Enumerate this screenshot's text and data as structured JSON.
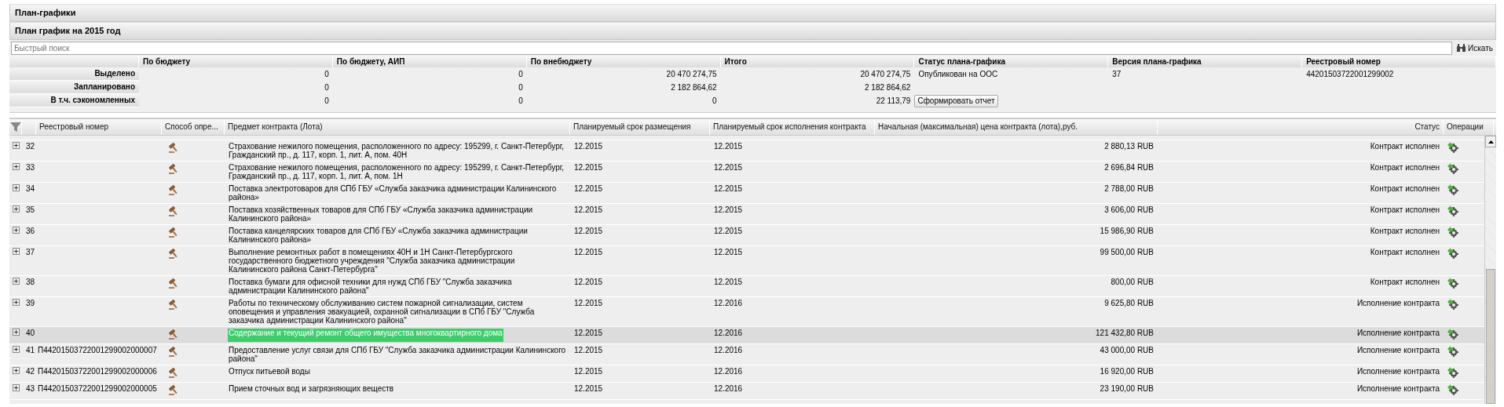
{
  "panel": {
    "title": "План-графики"
  },
  "plan": {
    "title": "План график на 2015 год"
  },
  "search": {
    "placeholder": "Быстрый поиск",
    "button": "Искать"
  },
  "summary": {
    "columns": [
      "По бюджету",
      "По бюджету, АИП",
      "По внебюджету",
      "Итого",
      "Статус плана-графика",
      "Версия плана-графика",
      "Реестровый номер"
    ],
    "rows": [
      {
        "label": "Выделено",
        "cells": [
          "0",
          "0",
          "20 470 274,75",
          "20 470 274,75",
          "Опубликован на ООС",
          "37",
          "44201503722001299002"
        ]
      },
      {
        "label": "Запланировано",
        "cells": [
          "0",
          "0",
          "2 182 864,62",
          "2 182 864,62"
        ]
      },
      {
        "label": "В т.ч. сэкономленных",
        "cells": [
          "0",
          "0",
          "0",
          "22 113,79"
        ]
      }
    ],
    "report_button": "Сформировать отчет"
  },
  "grid": {
    "columns": [
      "Реестровый номер",
      "Способ опре...",
      "Предмет контракта (Лота)",
      "Планируемый срок размещения",
      "Планируемый срок исполнения контракта",
      "Начальная (максимальная) цена контракта (лота),руб.",
      "Статус",
      "Операции"
    ],
    "rows": [
      {
        "number": "32",
        "subject": "Страхование нежилого помещения, расположенного по адресу: 195299, г. Санкт-Петербург, Гражданский пр., д. 117, корп. 1, лит. А, пом. 40Н",
        "placement": "12.2015",
        "execution": "12.2015",
        "price": "2 880,13 RUB",
        "status": "Контракт исполнен",
        "selected": false,
        "highlighted": false
      },
      {
        "number": "33",
        "subject": "Страхование нежилого помещения, расположенного по адресу: 195299, г. Санкт-Петербург, Гражданский пр., д. 117, корп. 1, лит. А, пом. 1Н",
        "placement": "12.2015",
        "execution": "12.2015",
        "price": "2 696,84 RUB",
        "status": "Контракт исполнен",
        "selected": false,
        "highlighted": false
      },
      {
        "number": "34",
        "subject": "Поставка электротоваров для СПб ГБУ «Служба заказчика администрации Калининского района»",
        "placement": "12.2015",
        "execution": "12.2015",
        "price": "2 788,00 RUB",
        "status": "Контракт исполнен",
        "selected": false,
        "highlighted": false
      },
      {
        "number": "35",
        "subject": "Поставка хозяйственных товаров для СПб ГБУ «Служба заказчика администрации Калининского района»",
        "placement": "12.2015",
        "execution": "12.2015",
        "price": "3 606,00 RUB",
        "status": "Контракт исполнен",
        "selected": false,
        "highlighted": false
      },
      {
        "number": "36",
        "subject": "Поставка канцелярских товаров для СПб ГБУ «Служба заказчика администрации Калининского района»",
        "placement": "12.2015",
        "execution": "12.2015",
        "price": "15 986,90 RUB",
        "status": "Контракт исполнен",
        "selected": false,
        "highlighted": false
      },
      {
        "number": "37",
        "subject": "Выполнение ремонтных работ в помещениях 40Н и 1Н Санкт-Петербургского государственного бюджетного учреждения \"Служба заказчика администрации Калининского района Санкт-Петербурга\"",
        "placement": "12.2015",
        "execution": "12.2015",
        "price": "99 500,00 RUB",
        "status": "Контракт исполнен",
        "selected": false,
        "highlighted": false
      },
      {
        "number": "38",
        "subject": "Поставка бумаги для офисной техники для нужд СПб ГБУ \"Служба заказчика администрации Калининского района\"",
        "placement": "12.2015",
        "execution": "12.2015",
        "price": "800,00 RUB",
        "status": "Контракт исполнен",
        "selected": false,
        "highlighted": false
      },
      {
        "number": "39",
        "subject": "Работы по техническому обслуживанию систем пожарной сигнализации, систем оповещения и управления эвакуацией, охранной сигнализации в СПб ГБУ \"Служба заказчика администрации Калининского района\"",
        "placement": "12.2015",
        "execution": "12.2016",
        "price": "9 625,80 RUB",
        "status": "Исполнение контракта",
        "selected": false,
        "highlighted": false
      },
      {
        "number": "40",
        "subject": "Содержание и текущий ремонт общего имущества многоквартирного дома",
        "placement": "12.2015",
        "execution": "12.2016",
        "price": "121 432,80 RUB",
        "status": "Исполнение контракта",
        "selected": true,
        "highlighted": true
      },
      {
        "number": "41",
        "registry": "П44201503722001299002000007",
        "subject": "Предоставление услуг связи для СПб ГБУ \"Служба заказчика администрации Калининского района\"",
        "placement": "12.2015",
        "execution": "12.2016",
        "price": "43 000,00 RUB",
        "status": "Исполнение контракта",
        "selected": false,
        "highlighted": false
      },
      {
        "number": "42",
        "registry": "П44201503722001299002000006",
        "subject": "Отпуск питьевой воды",
        "placement": "12.2015",
        "execution": "12.2016",
        "price": "16 920,00 RUB",
        "status": "Исполнение контракта",
        "selected": false,
        "highlighted": false
      },
      {
        "number": "43",
        "registry": "П44201503722001299002000005",
        "subject": "Прием сточных вод и загрязняющих веществ",
        "placement": "12.2015",
        "execution": "12.2016",
        "price": "23 190,00 RUB",
        "status": "Исполнение контракта",
        "selected": false,
        "highlighted": false
      }
    ]
  }
}
